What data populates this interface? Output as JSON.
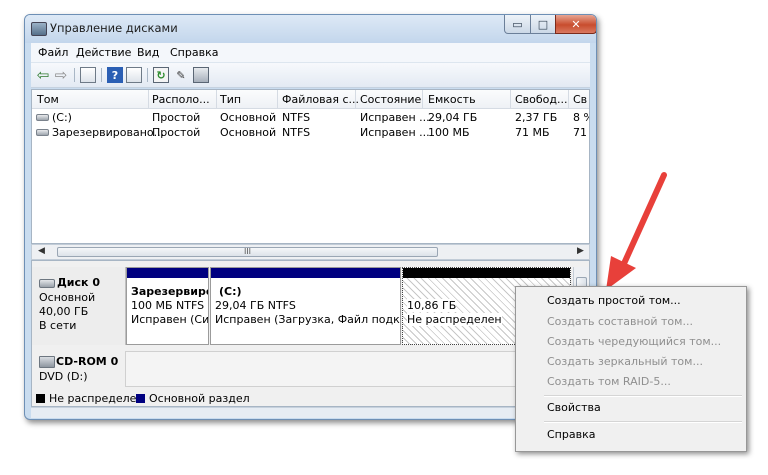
{
  "window": {
    "title": "Управление дисками",
    "controls": {
      "minimize": "▭",
      "maximize": "□",
      "close": "✕"
    }
  },
  "menu": [
    "Файл",
    "Действие",
    "Вид",
    "Справка"
  ],
  "toolbar": [
    "back-icon",
    "forward-icon",
    "console-icon",
    "help-icon",
    "properties-icon",
    "refresh-icon",
    "settings-icon",
    "disk-wizard-icon"
  ],
  "volume_table": {
    "columns": [
      "Том",
      "Располо...",
      "Тип",
      "Файловая с...",
      "Состояние",
      "Емкость",
      "Свобод...",
      "Св"
    ],
    "rows": [
      [
        "(C:)",
        "Простой",
        "Основной",
        "NTFS",
        "Исправен ...",
        "29,04 ГБ",
        "2,37 ГБ",
        "8 %"
      ],
      [
        "Зарезервировано...",
        "Простой",
        "Основной",
        "NTFS",
        "Исправен ...",
        "100 МБ",
        "71 МБ",
        "71"
      ]
    ],
    "scroll_thumb": "III"
  },
  "disks": {
    "disk0": {
      "name": "Диск 0",
      "type": "Основной",
      "size": "40,00 ГБ",
      "status": "В сети",
      "partitions": [
        {
          "title": "Зарезервиро",
          "size": "100 МБ NTFS",
          "status": "Исправен (Си"
        },
        {
          "title": "(C:)",
          "size": "29,04 ГБ NTFS",
          "status": "Исправен (Загрузка, Файл подкачки"
        },
        {
          "size": "10,86 ГБ",
          "status": "Не распределен"
        }
      ]
    },
    "cdrom": {
      "name": "CD-ROM 0",
      "type": "DVD (D:)"
    }
  },
  "legend": {
    "unallocated": "Не распределен",
    "primary": "Основной раздел",
    "unallocated_color": "#000000",
    "primary_color": "#000080"
  },
  "context_menu": {
    "items": [
      {
        "label": "Создать простой том...",
        "enabled": true
      },
      {
        "label": "Создать составной том...",
        "enabled": false
      },
      {
        "label": "Создать чередующийся том...",
        "enabled": false
      },
      {
        "label": "Создать зеркальный том...",
        "enabled": false
      },
      {
        "label": "Создать том RAID-5...",
        "enabled": false
      }
    ],
    "properties": "Свойства",
    "help": "Справка"
  },
  "colors": {
    "primary_bar": "#000080",
    "unallocated_bar": "#000000",
    "annotation_arrow": "#e8403a"
  }
}
